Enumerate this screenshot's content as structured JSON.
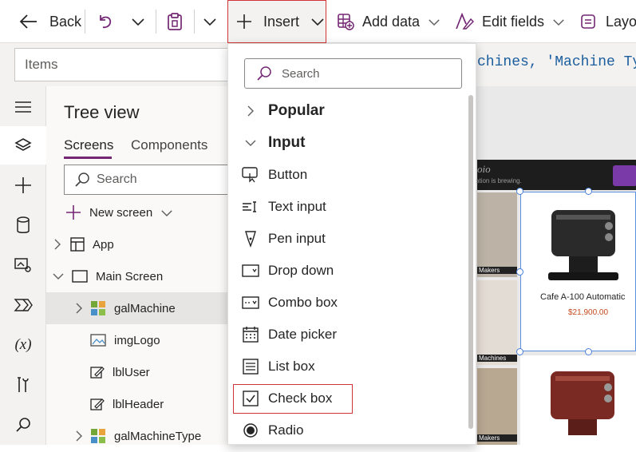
{
  "toolbar": {
    "back_label": "Back",
    "insert_label": "Insert",
    "add_data_label": "Add data",
    "edit_fields_label": "Edit fields",
    "layout_label": "Layo"
  },
  "formula": {
    "property": "Items",
    "text": "chines, 'Machine Ty"
  },
  "tree": {
    "title": "Tree view",
    "tabs": [
      "Screens",
      "Components"
    ],
    "search_placeholder": "Search",
    "new_screen_label": "New screen",
    "nodes": [
      {
        "label": "App"
      },
      {
        "label": "Main Screen"
      },
      {
        "label": "galMachine"
      },
      {
        "label": "imgLogo"
      },
      {
        "label": "lblUser"
      },
      {
        "label": "lblHeader"
      },
      {
        "label": "galMachineType"
      }
    ]
  },
  "menu": {
    "search_placeholder": "Search",
    "categories": [
      "Popular",
      "Input"
    ],
    "items": [
      "Button",
      "Text input",
      "Pen input",
      "Drop down",
      "Combo box",
      "Date picker",
      "List box",
      "Check box",
      "Radio"
    ]
  },
  "canvas": {
    "header_logo": "oio",
    "header_sub": "ation is brewing.",
    "thumbs": [
      "Makers",
      "Machines",
      "Makers"
    ],
    "product_name": "Cafe A-100 Automatic",
    "product_price": "$21,900.00"
  },
  "colors": {
    "accent": "#742774",
    "highlight": "#d13438",
    "price": "#c4491f"
  }
}
